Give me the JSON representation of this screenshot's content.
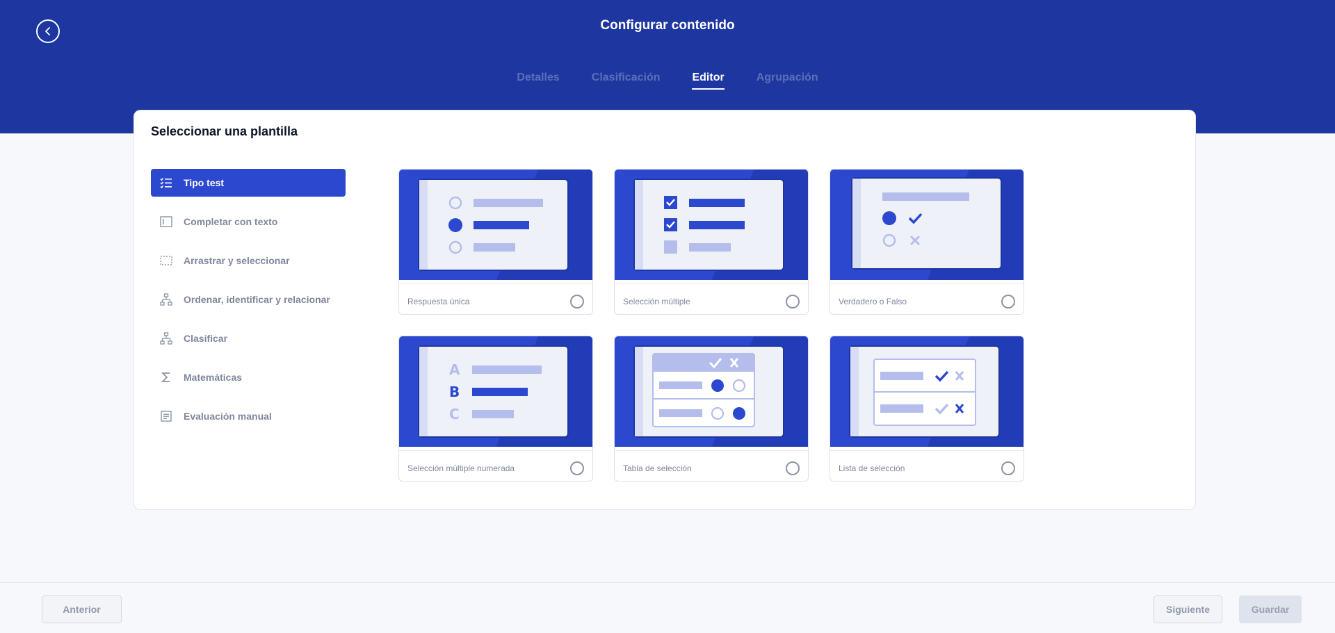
{
  "header": {
    "title": "Configurar contenido",
    "tabs": [
      {
        "label": "Detalles",
        "active": false
      },
      {
        "label": "Clasificación",
        "active": false
      },
      {
        "label": "Editor",
        "active": true
      },
      {
        "label": "Agrupación",
        "active": false
      }
    ]
  },
  "panel": {
    "title": "Seleccionar una plantilla"
  },
  "menu": {
    "items": [
      {
        "label": "Tipo test",
        "icon": "checklist-icon",
        "active": true
      },
      {
        "label": "Completar con texto",
        "icon": "text-field-icon",
        "active": false
      },
      {
        "label": "Arrastrar y seleccionar",
        "icon": "dashed-select-icon",
        "active": false
      },
      {
        "label": "Ordenar, identificar y relacionar",
        "icon": "hierarchy-icon",
        "active": false
      },
      {
        "label": "Clasificar",
        "icon": "hierarchy-icon",
        "active": false
      },
      {
        "label": "Matemáticas",
        "icon": "sigma-icon",
        "active": false
      },
      {
        "label": "Evaluación manual",
        "icon": "document-icon",
        "active": false
      }
    ]
  },
  "templates": [
    {
      "label": "Respuesta única",
      "selected": false
    },
    {
      "label": "Selección múltiple",
      "selected": false
    },
    {
      "label": "Verdadero o Falso",
      "selected": false
    },
    {
      "label": "Selección múltiple numerada",
      "selected": false
    },
    {
      "label": "Tabla de selección",
      "selected": false
    },
    {
      "label": "Lista de selección",
      "selected": false
    }
  ],
  "footer": {
    "prev_label": "Anterior",
    "next_label": "Siguiente",
    "save_label": "Guardar"
  },
  "colors": {
    "header_bg": "#1e36a0",
    "accent": "#2b48cf",
    "tile_bg": "#2b48cf",
    "light_accent": "#b4bdec",
    "panel_bg": "#eef2f8"
  }
}
